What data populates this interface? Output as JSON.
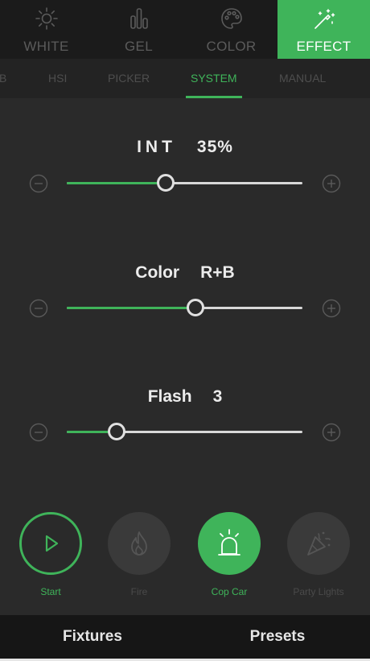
{
  "top_tabs": [
    {
      "label": "WHITE",
      "icon": "sun-icon",
      "active": false
    },
    {
      "label": "GEL",
      "icon": "gel-bars-icon",
      "active": false
    },
    {
      "label": "COLOR",
      "icon": "palette-icon",
      "active": false
    },
    {
      "label": "EFFECT",
      "icon": "magic-wand-icon",
      "active": true
    }
  ],
  "sub_tabs": [
    {
      "label": "B",
      "active": false
    },
    {
      "label": "HSI",
      "active": false
    },
    {
      "label": "PICKER",
      "active": false
    },
    {
      "label": "SYSTEM",
      "active": true
    },
    {
      "label": "MANUAL",
      "active": false
    }
  ],
  "sliders": [
    {
      "name": "INT",
      "value_text": "35%",
      "fraction": 0.42
    },
    {
      "name": "Color",
      "value_text": "R+B",
      "fraction": 0.545
    },
    {
      "name": "Flash",
      "value_text": "3",
      "fraction": 0.21
    }
  ],
  "effects": [
    {
      "label": "Start",
      "icon": "play-icon",
      "state": "outline"
    },
    {
      "label": "Fire",
      "icon": "flame-icon",
      "state": "dim"
    },
    {
      "label": "Cop Car",
      "icon": "siren-icon",
      "state": "on"
    },
    {
      "label": "Party Lights",
      "icon": "party-popper-icon",
      "state": "dim"
    }
  ],
  "bottom_bar": {
    "fixtures_label": "Fixtures",
    "presets_label": "Presets"
  },
  "colors": {
    "accent": "#3fb45a",
    "background": "#2a2a2a",
    "inactive_text": "#5b5b5b"
  }
}
